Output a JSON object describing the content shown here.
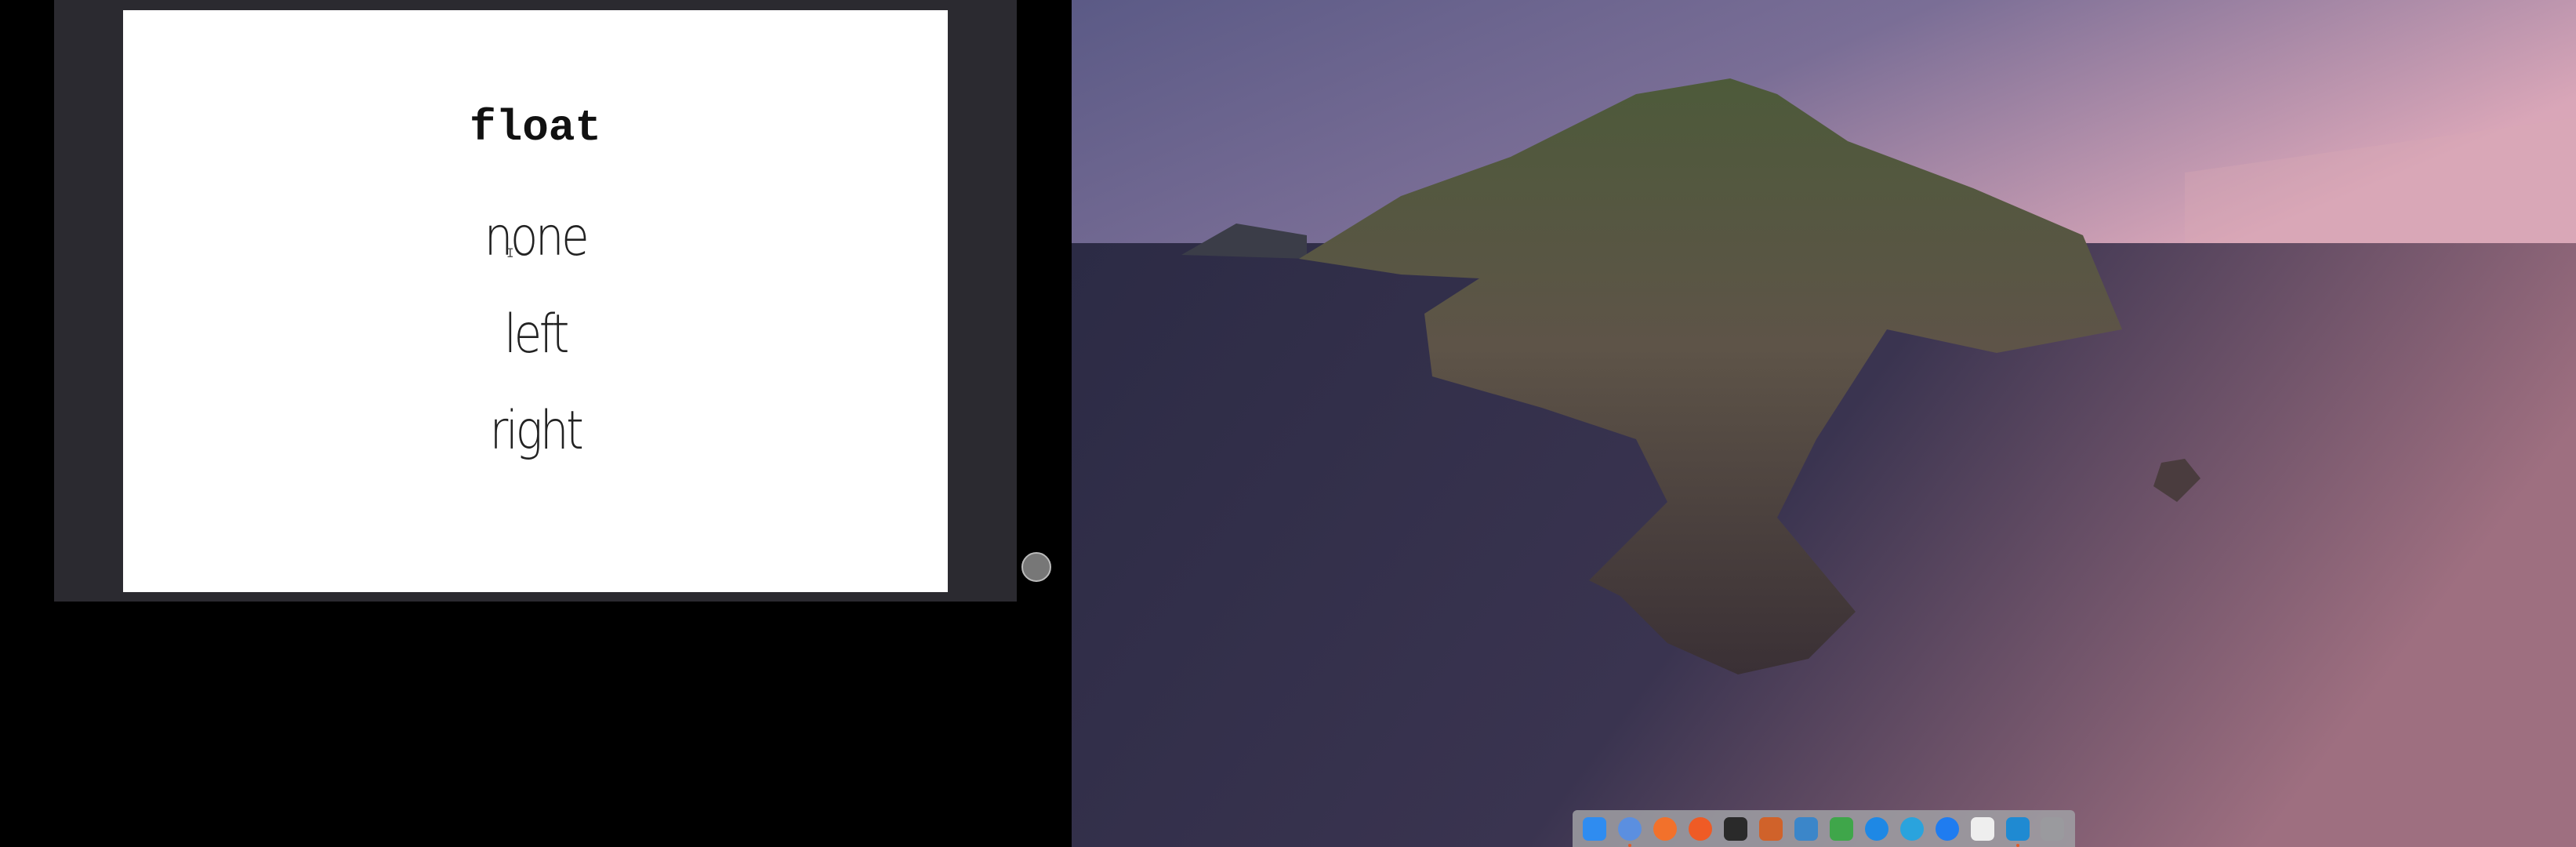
{
  "slide": {
    "title": "float",
    "options": [
      "none",
      "left",
      "right"
    ]
  },
  "cursor": {
    "icon": "text-cursor-icon",
    "glyph": "I"
  },
  "dock": {
    "items": [
      {
        "name": "finder",
        "color": "#2f8cf0",
        "running": false
      },
      {
        "name": "chromium",
        "color": "#5b8fe0",
        "running": true
      },
      {
        "name": "firefox",
        "color": "#f2712b",
        "running": false
      },
      {
        "name": "postman",
        "color": "#ef5b25",
        "running": false
      },
      {
        "name": "terminal",
        "color": "#2a2a2a",
        "running": false
      },
      {
        "name": "libreoffice-impress",
        "color": "#d0622a",
        "running": false
      },
      {
        "name": "libreoffice-draw",
        "color": "#3b86c9",
        "running": false
      },
      {
        "name": "libreoffice-calc",
        "color": "#3fa64a",
        "running": false
      },
      {
        "name": "teamviewer",
        "color": "#1e88e5",
        "running": false
      },
      {
        "name": "telegram",
        "color": "#2aa3dd",
        "running": false
      },
      {
        "name": "app-store",
        "color": "#1f7cf0",
        "running": false
      },
      {
        "name": "textedit",
        "color": "#eeeeee",
        "running": false
      },
      {
        "name": "vscode",
        "color": "#1f8ad2",
        "running": true
      },
      {
        "name": "launchpad",
        "color": "#9a9a9e",
        "running": false
      }
    ]
  }
}
